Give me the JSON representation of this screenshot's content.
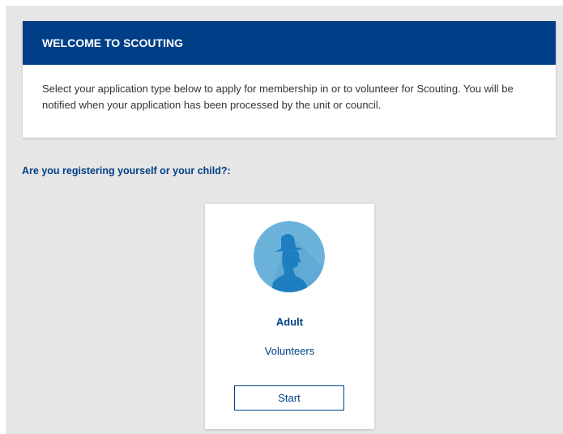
{
  "welcome": {
    "title": "WELCOME TO SCOUTING",
    "body": "Select your application type below to apply for membership in or to volunteer for Scouting. You will be notified when your application has been processed by the unit or council."
  },
  "question": "Are you registering yourself or your child?:",
  "options": [
    {
      "icon": "scout-silhouette-icon",
      "title": "Adult",
      "subtitle": "Volunteers",
      "button_label": "Start"
    }
  ],
  "colors": {
    "brand_blue": "#003f87",
    "avatar_blue": "#6cb3dc",
    "silhouette_blue": "#1d7fc0",
    "page_bg": "#e6e6e6"
  }
}
